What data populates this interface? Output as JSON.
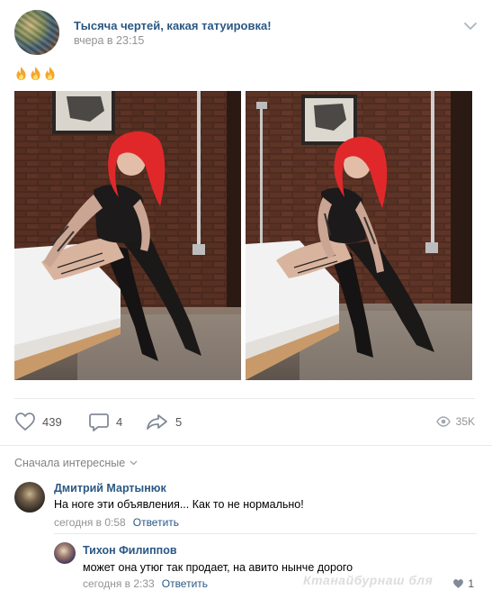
{
  "post": {
    "group_name": "Тысяча чертей, какая татуировка!",
    "time": "вчера в 23:15",
    "emoji_count": 3,
    "emoji_icon": "fire-icon"
  },
  "photos": [
    {
      "description_icon": "photo-tattooed-woman-on-bed"
    },
    {
      "description_icon": "photo-tattooed-woman-on-bed"
    }
  ],
  "actions": {
    "likes": "439",
    "comments": "4",
    "shares": "5",
    "views": "35K"
  },
  "comments_section": {
    "sort_label": "Сначала интересные"
  },
  "comments": [
    {
      "author": "Дмитрий Мартынюк",
      "text": "На ноге эти объявления... Как то не нормально!",
      "time": "сегодня в 0:58",
      "reply_label": "Ответить"
    },
    {
      "author": "Тихон Филиппов",
      "text": "может она утюг так продает, на авито нынче дорого",
      "time": "сегодня в 2:33",
      "reply_label": "Ответить",
      "likes": "1"
    }
  ],
  "watermark": "Ктанайбурнаш бля",
  "colors": {
    "link": "#2a5885",
    "meta": "#939393",
    "divider": "#e7e8ec",
    "hair": "#e0282b"
  }
}
